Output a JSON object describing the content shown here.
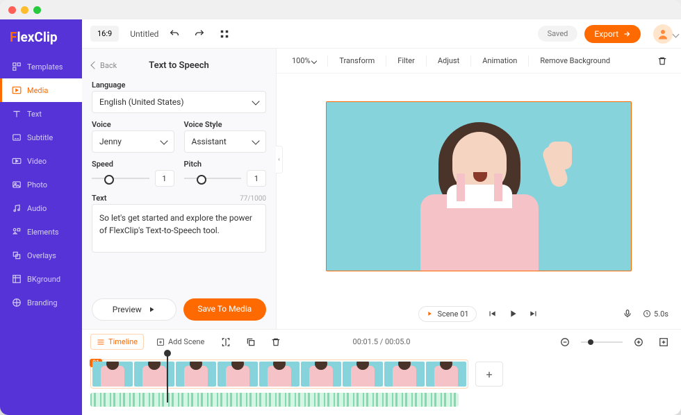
{
  "brand": {
    "name_pre": "F",
    "name_post": "lexClip"
  },
  "sidebar": {
    "items": [
      {
        "label": "Templates"
      },
      {
        "label": "Media"
      },
      {
        "label": "Text"
      },
      {
        "label": "Subtitle"
      },
      {
        "label": "Video"
      },
      {
        "label": "Photo"
      },
      {
        "label": "Audio"
      },
      {
        "label": "Elements"
      },
      {
        "label": "Overlays"
      },
      {
        "label": "BKground"
      },
      {
        "label": "Branding"
      }
    ]
  },
  "topbar": {
    "ratio": "16:9",
    "title": "Untitled",
    "saved": "Saved",
    "export": "Export"
  },
  "panel": {
    "back": "Back",
    "title": "Text to Speech",
    "language_label": "Language",
    "language_value": "English (United States)",
    "voice_label": "Voice",
    "voice_value": "Jenny",
    "voice_style_label": "Voice Style",
    "voice_style_value": "Assistant",
    "speed_label": "Speed",
    "speed_value": "1",
    "pitch_label": "Pitch",
    "pitch_value": "1",
    "text_label": "Text",
    "text_counter": "77/1000",
    "text_value": "So let's get started and explore the power of FlexClip's Text-to-Speech tool.",
    "preview": "Preview",
    "save": "Save To Media"
  },
  "canvas_toolbar": {
    "zoom": "100%",
    "transform": "Transform",
    "filter": "Filter",
    "adjust": "Adjust",
    "animation": "Animation",
    "remove_bg": "Remove Background"
  },
  "playback": {
    "scene": "Scene 01",
    "speed_icon": "gear",
    "duration": "5.0s"
  },
  "timeline": {
    "label": "Timeline",
    "add_scene": "Add Scene",
    "time": "00:01.5 / 00:05.0",
    "clip_badge": "01"
  }
}
